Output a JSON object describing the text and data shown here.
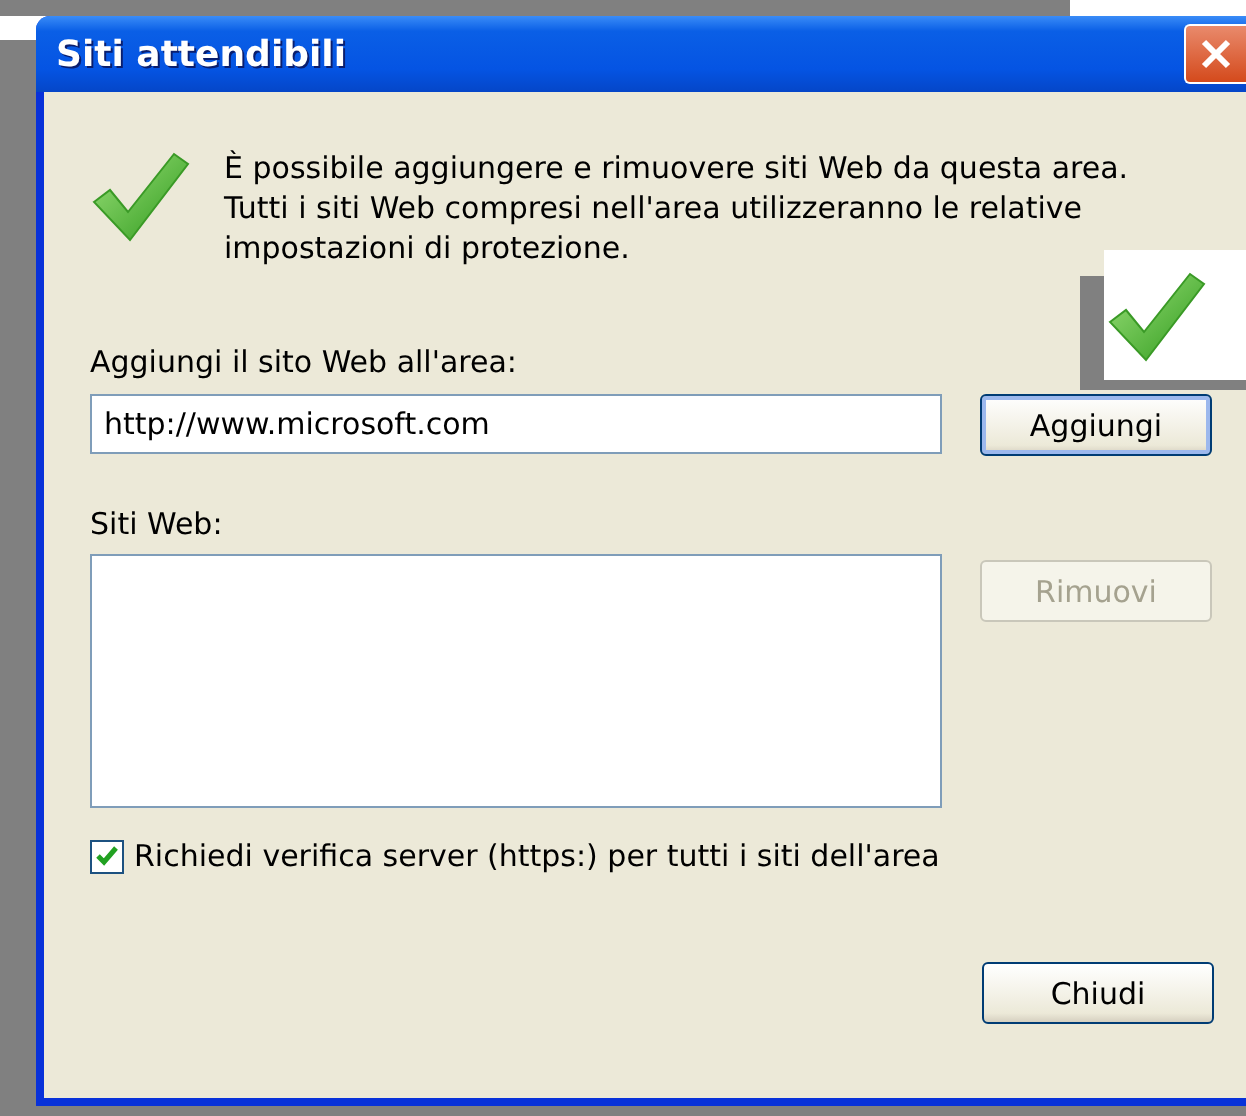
{
  "window": {
    "title": "Siti attendibili"
  },
  "intro": "È possibile aggiungere e rimuovere siti Web da questa area. Tutti i siti Web compresi nell'area utilizzeranno le relative impostazioni di protezione.",
  "add_label": "Aggiungi il sito Web all'area:",
  "add_field": {
    "value": "http://www.microsoft.com"
  },
  "add_button": {
    "label": "Aggiungi",
    "disabled": false
  },
  "sites_label": "Siti Web:",
  "remove_button": {
    "label": "Rimuovi",
    "disabled": true
  },
  "https_checkbox": {
    "label": "Richiedi verifica server (https:) per tutti i siti dell'area",
    "checked": true
  },
  "close_button": {
    "label": "Chiudi",
    "disabled": false
  }
}
